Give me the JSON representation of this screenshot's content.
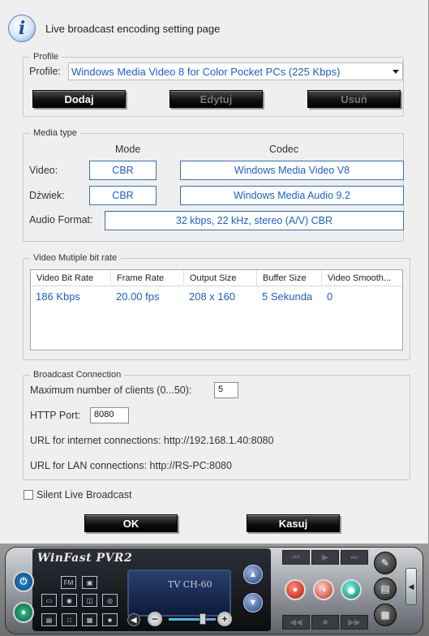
{
  "title": "Live broadcast encoding setting page",
  "profile_group": {
    "legend": "Profile",
    "label": "Profile:",
    "selected": "Windows Media Video 8 for Color Pocket PCs (225 Kbps)",
    "buttons": {
      "add": "Dodaj",
      "edit": "Edytuj",
      "delete": "Usuń"
    }
  },
  "media_group": {
    "legend": "Media type",
    "col_mode": "Mode",
    "col_codec": "Codec",
    "video_label": "Video:",
    "video_mode": "CBR",
    "video_codec": "Windows Media Video V8",
    "audio_label": "Dźwiek:",
    "audio_mode": "CBR",
    "audio_codec": "Windows Media Audio 9.2",
    "format_label": "Audio Format:",
    "format_value": "32 kbps, 22 kHz, stereo (A/V) CBR"
  },
  "bitrate_group": {
    "legend": "Video Mutiple bit rate",
    "columns": [
      "Video Bit Rate",
      "Frame Rate",
      "Output Size",
      "Buffer Size",
      "Video Smooth..."
    ],
    "rows": [
      [
        "186 Kbps",
        "20.00 fps",
        "208 x 160",
        "5 Sekunda",
        "0"
      ]
    ]
  },
  "broadcast_group": {
    "legend": "Broadcast Connection",
    "max_clients_label": "Maximum number of clients (0...50):",
    "max_clients_value": "5",
    "http_port_label": "HTTP Port:",
    "http_port_value": "8080",
    "internet_url": "URL for internet connections: http://192.168.1.40:8080",
    "lan_url": "URL for LAN connections: http://RS-PC:8080"
  },
  "silent_label": "Silent Live Broadcast",
  "ok_label": "OK",
  "cancel_label": "Kasuj",
  "pvr": {
    "logo": "WinFast PVR2",
    "screen_text": "TV CH-60",
    "fm_label": "FM"
  }
}
